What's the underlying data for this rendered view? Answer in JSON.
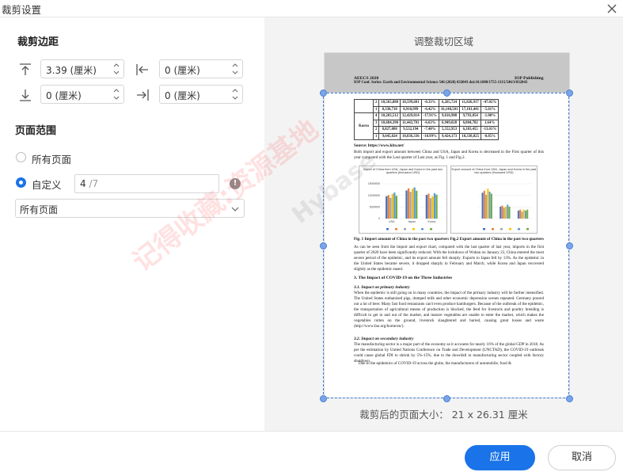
{
  "window": {
    "title": "裁剪设置"
  },
  "margins": {
    "title": "裁剪边距",
    "top": "3.39 (厘米)",
    "left": "0 (厘米)",
    "bottom": "0 (厘米)",
    "right": "0 (厘米)"
  },
  "page_range": {
    "title": "页面范围",
    "all_pages": "所有页面",
    "custom": "自定义",
    "custom_value": "4",
    "custom_total": " /7",
    "select_value": "所有页面"
  },
  "preview": {
    "title": "调整裁切区域",
    "size_label": "裁剪后的页面大小：  21 x 26.31 厘米",
    "doc": {
      "header_left": "AEECS 2020",
      "header_right": "IOP Publishing",
      "header_line2": "IOP Conf. Series: Earth and Environmental Science 546 (2020) 032043      doi:10.1088/1755-1315/546/3/032043",
      "table_rows": [
        [
          "",
          "2",
          "10,565,888",
          "10,599,681",
          "-0.33%",
          "6,265,724",
          "11,826,917",
          "-47.02%"
        ],
        [
          "",
          "1",
          "8,338,718",
          "8,910,999",
          "-6.42%",
          "16,148,501",
          "17,101,441",
          "-5.61%"
        ],
        [
          "Korea",
          "4",
          "10,203,512",
          "12,429,814",
          "-17.91%",
          "9,616,988",
          "9,793,054",
          "-1.80%"
        ],
        [
          "",
          "3",
          "10,684,390",
          "11,442,781",
          "-6.63%",
          "6,949,028",
          "6,804,782",
          "1.64%"
        ],
        [
          "",
          "2",
          "8,827,088",
          "9,532,194",
          "-7.40%",
          "5,552,953",
          "6,383,455",
          "-13.01%"
        ],
        [
          "",
          "1",
          "9,645,024",
          "10,836,336",
          "-10.99%",
          "9,424,173",
          "10,338,825",
          "-8.85%"
        ]
      ],
      "source": "Source: https://www.kita.net/",
      "para1": "Both import and export amount between China and USA, Japan and Korea is decreased in the First quarter of this year compared with the Last quarter of Last year, as Fig. 1 and Fig.2.",
      "chart1_title": "Import of China from USA, Japan and Korea in the past two quarters (thousand USD)",
      "chart2_title": "Export amount of China from USA, Japan and Korea in the past two quarters (thousand USD)",
      "chart1_yticks": [
        "15000000",
        "10000000",
        "5000000",
        "0"
      ],
      "chart1_x": [
        "USA",
        "Japan",
        "Korea"
      ],
      "fig_caption": "Fig. 1 Import amount of China in the past two quarters     Fig.2 Export amount of China in the past two quarters",
      "para2": "As can be seen from the import and export chart, compared with the last quarter of last year, imports in the first quarter of 2020 have been significantly reduced. With the lockdown of Wuhan on January 23, China entered the most severe period of the epidemic, and its export amount fell sharply. Exports to Japan fell by 13%. As the epidemic in the United States became severe, it dropped sharply in February and March, while Korea and Japan recovered slightly as the epidemic eased.",
      "sec3": "3. The Impact of COVID-19 on the Three Industries",
      "sec31": "3.1. Impact on primary industry",
      "para3": "When the epidemic is still going on in many countries, the impact of the primary industry will be further intensified. The United States euthanized pigs, dumped milk and other economic depression scenes repeated. Germany poured out a lot of beer. Many fast food restaurants can't even produce hamburgers. Because of the outbreak of the epidemic, the transportation of agricultural means of production is blocked, the feed for livestock and poultry breeding is difficult to get in and out of the market, and mature vegetables are unable to enter the market, which makes the vegetables rotten on the ground, livestock slaughtered and buried, causing great losses and waste (http://www.fao.org/home/en/).",
      "sec32": "3.2. Impact on secondary industry",
      "para4": "The manufacturing sector is a major part of the economy as it accounts for nearly 16% of the global GDP in 2018. As per the estimation by United Nations Conference on Trade and Development (UNCTAD), the COVID-19 outbreak could cause global FDI to shrink by 5%-15%, due to the downfall in manufacturing sector coupled with factory shutdown.",
      "para5": "Due to the epidemics of COVID-19 across the globe, the manufacturers of automobile, food &"
    },
    "chart1": {
      "groups": [
        "USA",
        "Japan",
        "Korea"
      ],
      "series_colors": [
        "#4472c4",
        "#ed7d31",
        "#a5a5a5",
        "#ffc000",
        "#5b9bd5",
        "#70ad47"
      ],
      "values": [
        [
          9.6,
          10.1,
          8.9,
          10.6,
          11.2,
          9.8
        ],
        [
          12.1,
          13.0,
          11.5,
          12.8,
          13.4,
          12.0
        ],
        [
          10.2,
          10.7,
          8.8,
          9.6,
          10.9,
          10.3
        ]
      ],
      "ymax": 15
    },
    "chart2": {
      "groups": [
        "USA",
        "Japan",
        "Korea"
      ],
      "series_colors": [
        "#4472c4",
        "#ed7d31",
        "#a5a5a5",
        "#ffc000",
        "#5b9bd5",
        "#70ad47"
      ],
      "values": [
        [
          26,
          28,
          24,
          30,
          27,
          25
        ],
        [
          12,
          13,
          11,
          12,
          14,
          12
        ],
        [
          8,
          9,
          7,
          9,
          8,
          9
        ]
      ],
      "ymax": 35
    }
  },
  "footer": {
    "apply": "应用",
    "cancel": "取消"
  },
  "watermark": {
    "text1": "记得收藏:资源基地",
    "text2": "Hybase"
  }
}
